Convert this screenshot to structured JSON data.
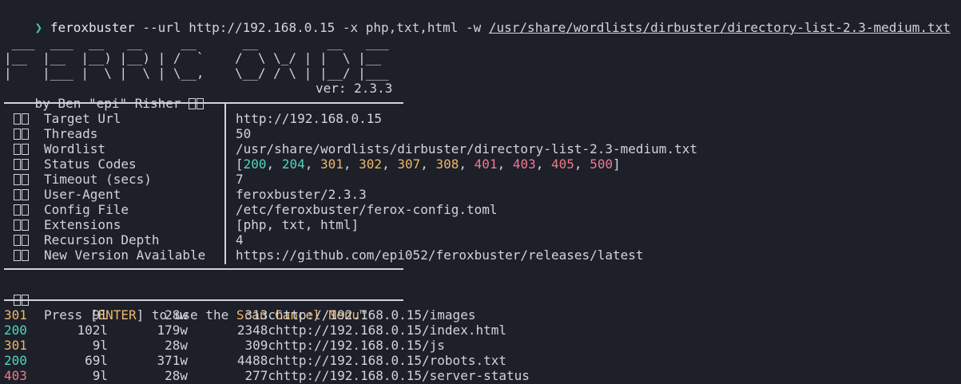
{
  "command": {
    "prompt": "❯",
    "binary": "feroxbuster",
    "args": " --url http://192.168.0.15 -x php,txt,html -w ",
    "wordlist_path": "/usr/share/wordlists/dirbuster/directory-list-2.3-medium.txt"
  },
  "banner": {
    "art_lines": [
      " ___  ___  __   __     __      __         __   ___",
      "|__  |__  |__) |__) | /  `    /  \\ \\_/ | |  \\ |__",
      "|    |___ |  \\ |  \\ | \\__,    \\__/ / \\ | |__/ |___"
    ],
    "author": "by Ben \"epi\" Risher",
    "version": "ver: 2.3.3"
  },
  "config": [
    {
      "key": "Target Url",
      "value": "http://192.168.0.15"
    },
    {
      "key": "Threads",
      "value": "50"
    },
    {
      "key": "Wordlist",
      "value": "/usr/share/wordlists/dirbuster/directory-list-2.3-medium.txt"
    },
    {
      "key": "Status Codes",
      "value": ""
    },
    {
      "key": "Timeout (secs)",
      "value": "7"
    },
    {
      "key": "User-Agent",
      "value": "feroxbuster/2.3.3"
    },
    {
      "key": "Config File",
      "value": "/etc/feroxbuster/ferox-config.toml"
    },
    {
      "key": "Extensions",
      "value": "[php, txt, html]"
    },
    {
      "key": "Recursion Depth",
      "value": "4"
    },
    {
      "key": "New Version Available",
      "value": "https://github.com/epi052/feroxbuster/releases/latest"
    }
  ],
  "status_codes": {
    "open": "[",
    "close": "]",
    "sep": ", ",
    "codes": [
      "200",
      "204",
      "301",
      "302",
      "307",
      "308",
      "401",
      "403",
      "405",
      "500"
    ],
    "colors": [
      "#4fd6be",
      "#4fd6be",
      "#ebb869",
      "#ebb869",
      "#ebb869",
      "#ebb869",
      "#f07a8e",
      "#f07a8e",
      "#f07a8e",
      "#f07a8e"
    ]
  },
  "cancel_hint": {
    "pre": "Press [",
    "key": "ENTER",
    "mid": "] to use the ",
    "menu": "Scan Cancel Menu",
    "tm": "™"
  },
  "results": [
    {
      "status": "301",
      "lines": "9l",
      "words": "28w",
      "chars": "313c",
      "url": "http://192.168.0.15/images",
      "color": "#ebb869"
    },
    {
      "status": "200",
      "lines": "102l",
      "words": "179w",
      "chars": "2348c",
      "url": "http://192.168.0.15/index.html",
      "color": "#4fd6be"
    },
    {
      "status": "301",
      "lines": "9l",
      "words": "28w",
      "chars": "309c",
      "url": "http://192.168.0.15/js",
      "color": "#ebb869"
    },
    {
      "status": "200",
      "lines": "69l",
      "words": "371w",
      "chars": "4488c",
      "url": "http://192.168.0.15/robots.txt",
      "color": "#4fd6be"
    },
    {
      "status": "403",
      "lines": "9l",
      "words": "28w",
      "chars": "277c",
      "url": "http://192.168.0.15/server-status",
      "color": "#f07a8e"
    }
  ]
}
